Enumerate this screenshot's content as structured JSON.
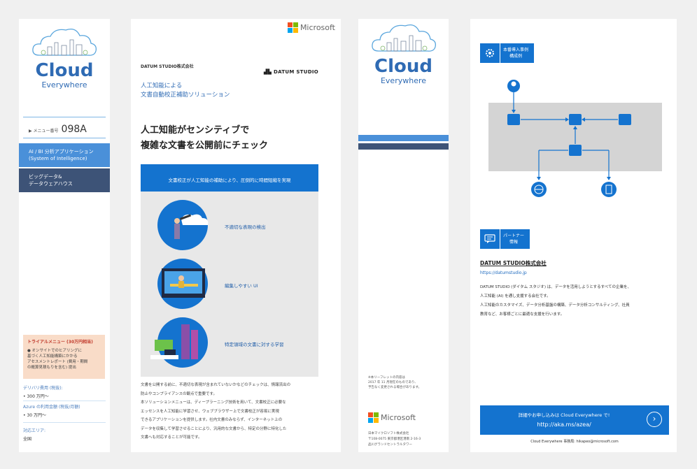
{
  "brand": {
    "cloud_word": "Cloud",
    "cloud_sub": "Everywhere",
    "microsoft": "Microsoft",
    "ms_colors": [
      "#f25022",
      "#7fba00",
      "#00a4ef",
      "#ffb900"
    ],
    "accent": "#1473cf",
    "navy": "#3d5377"
  },
  "left_panel": {
    "menu_number_label": "▶ メニュー番号",
    "menu_number": "098A",
    "category_active": [
      "AI / BI 分析アプリケーション",
      "(System of Intelligence)"
    ],
    "category_inactive": [
      "ビッグデータ&",
      "データウェアハウス"
    ],
    "trial": {
      "title": "トライアルメニュー (30万円相当)",
      "body": [
        "● オンサイトでのヒアリングに",
        "基づく人工知能構築にかかる",
        "アセスメントレポート (費用・期間",
        "の概算見積もりを含む) 提出"
      ]
    },
    "fee_label": "デリバリ費用 (税抜):",
    "fee_value": "• 300 万円〜",
    "azure_label": "Azure の利用金額 (税抜/月額)",
    "azure_value": "• 30 万円〜",
    "area_label": "対応エリア:",
    "area_value": "全国"
  },
  "brochure": {
    "company": "DATUM STUDIO株式会社",
    "datum_logo": "DATUM STUDIO",
    "subtitle": [
      "人工知能による",
      "文書自動校正補助ソリューション"
    ],
    "title": [
      "人工知能がセンシティブで",
      "複雑な文書を公開前にチェック"
    ],
    "band": "文書校正が人工知能の補助により、圧倒的に時間短縮を実現",
    "features": [
      "不適切な表現の検出",
      "編集しやすい UI",
      "特定領域の文書に対する学習"
    ],
    "body": [
      "文書を公開する前に、不適切な表現が含まれていないかなどのチェックは、情報流出の",
      "防止やコンプライアンスの観点で重要です。",
      "本ソリューションメニューは、ディープラーニング技術を用いて、文書校正に必要な",
      "エッセンスを人工知能に学習させ、ウェブブラウザー上で文書校正が容易に実現",
      "できるアプリケーションを提供します。社内文書のみならず、インターネット上の",
      "データを収集して学習させることにより、汎用的な文書から、特定の分野に特化した",
      "文書へも対応することが可能です。"
    ]
  },
  "middle_panel": {
    "note": [
      "※本リーフレットの内容は",
      "2017 年 11 月現在のものであり、",
      "予告なく変更される場合があります。"
    ],
    "footer": [
      "日本マイクロソフト株式会社",
      "〒108-0075 東京都港区港南 2-16-3",
      "品川グランドセントラルタワー"
    ]
  },
  "right_panel": {
    "case_title": [
      "本番導入事例",
      "構成例"
    ],
    "partner_title": [
      "パートナー",
      "情報"
    ],
    "partner_name": "DATUM STUDIO株式会社",
    "partner_url": "https://datumstudio.jp",
    "partner_desc": [
      "DATUM STUDIO (ダイタム スタジオ) は、データを活用しようとするすべての企業を、",
      "人工知能 (AI) を通し支援する会社です。",
      "人工知能のカスタマイズ、データ分析基盤の構築、データ分析コンサルティング、社員",
      "教育など、お客様ごとに最適な支援を行います。"
    ],
    "cta_line1": "詳細やお申し込みは Cloud Everywhere で!",
    "cta_line2": "http://aka.ms/azea/",
    "cta_arrow": "›",
    "contact": "Cloud Everywhere 事務局: hikapeo@microsoft.com"
  }
}
